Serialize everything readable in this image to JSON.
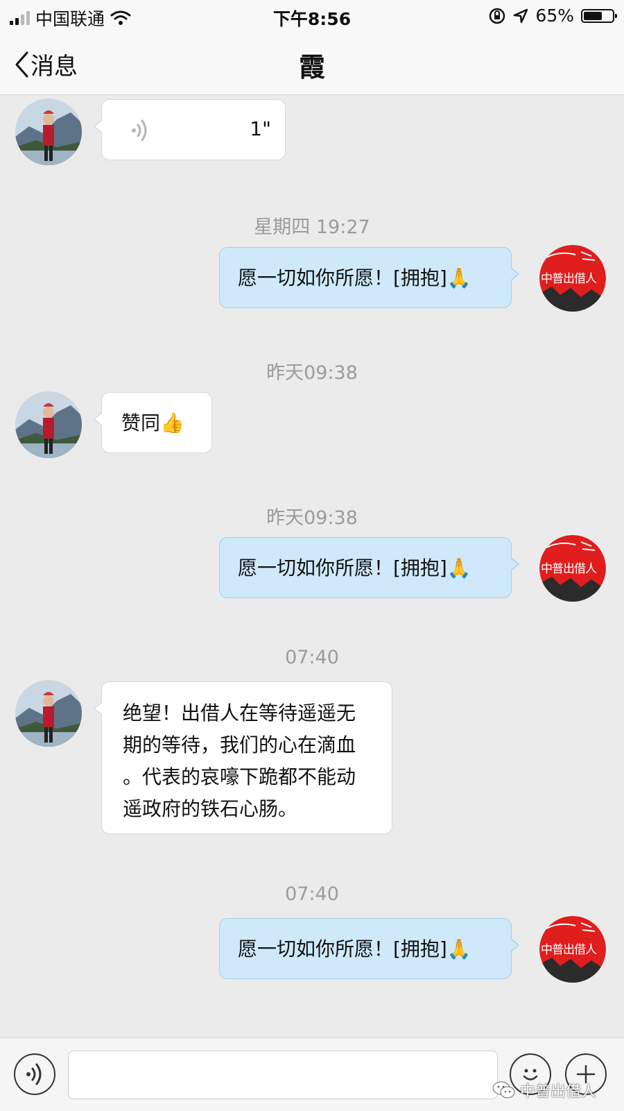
{
  "status_bar": {
    "carrier": "中国联通",
    "time": "下午8:56",
    "battery_percent": "65%",
    "battery_level": 0.65,
    "icons": [
      "signal-icon",
      "wifi-icon",
      "rotation-lock-icon",
      "location-arrow-icon",
      "battery-icon"
    ]
  },
  "nav": {
    "back_label": "消息",
    "title": "霞"
  },
  "messages": [
    {
      "type": "voice",
      "direction": "in",
      "duration": "1\""
    },
    {
      "type": "timestamp",
      "text": "星期四 19:27"
    },
    {
      "type": "text",
      "direction": "out",
      "text": "愿一切如你所愿！[拥抱]🙏"
    },
    {
      "type": "timestamp",
      "text": "昨天09:38"
    },
    {
      "type": "text",
      "direction": "in",
      "text": "赞同👍"
    },
    {
      "type": "timestamp",
      "text": "昨天09:38"
    },
    {
      "type": "text",
      "direction": "out",
      "text": "愿一切如你所愿！[拥抱]🙏"
    },
    {
      "type": "timestamp",
      "text": "07:40"
    },
    {
      "type": "text",
      "direction": "in",
      "lines": [
        "绝望！出借人在等待遥遥无",
        "期的等待，我们的心在滴血",
        "。代表的哀嚎下跪都不能动",
        "遥政府的铁石心肠。"
      ]
    },
    {
      "type": "timestamp",
      "text": "07:40"
    },
    {
      "type": "text",
      "direction": "out",
      "text": "愿一切如你所愿！[拥抱]🙏"
    }
  ],
  "avatars": {
    "contact_logo_text": "中普出借人"
  },
  "input_bar": {
    "value": "",
    "icons": [
      "voice-toggle-icon",
      "emoji-icon",
      "plus-icon"
    ]
  },
  "watermark": {
    "text": "中普出借人"
  },
  "colors": {
    "background": "#ebebeb",
    "incoming_bubble": "#ffffff",
    "outgoing_bubble": "#cfe9fb",
    "timestamp": "#9b9b9b",
    "logo_red": "#e01e1e"
  }
}
